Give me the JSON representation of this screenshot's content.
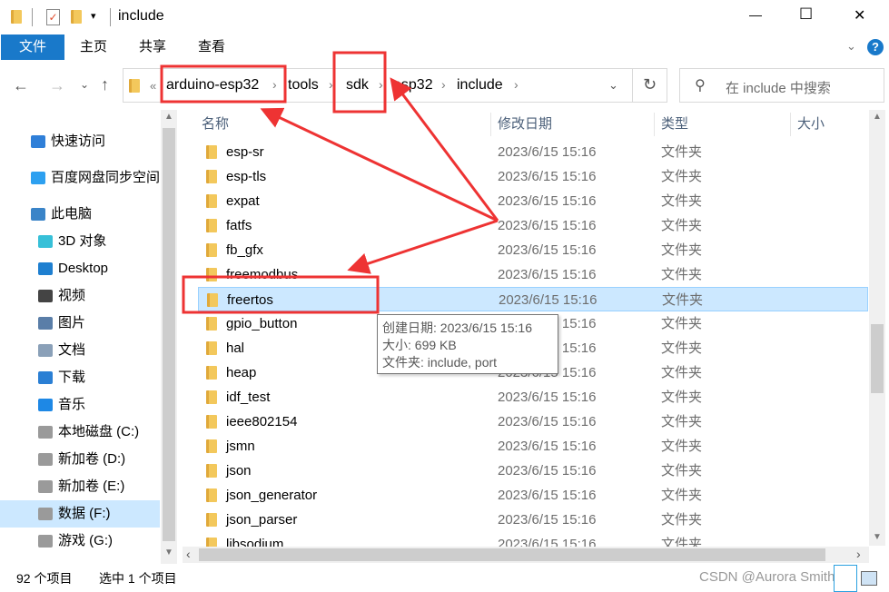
{
  "window": {
    "title": "include",
    "minimize": "—",
    "maximize": "☐",
    "close": "✕"
  },
  "ribbon": {
    "tabs": [
      "文件",
      "主页",
      "共享",
      "查看"
    ]
  },
  "address": {
    "overflow": "«",
    "crumbs": [
      "arduino-esp32",
      "tools",
      "sdk",
      "esp32",
      "include"
    ]
  },
  "search": {
    "placeholder": "在 include 中搜索"
  },
  "sidebar": {
    "items": [
      {
        "label": "快速访问",
        "icon": "star-icon"
      },
      {
        "label": "百度网盘同步空间",
        "icon": "baidu-netdisk-icon"
      },
      {
        "label": "此电脑",
        "icon": "computer-icon"
      },
      {
        "label": "3D 对象",
        "icon": "cube-icon"
      },
      {
        "label": "Desktop",
        "icon": "desktop-icon"
      },
      {
        "label": "视频",
        "icon": "video-icon"
      },
      {
        "label": "图片",
        "icon": "picture-icon"
      },
      {
        "label": "文档",
        "icon": "document-icon"
      },
      {
        "label": "下载",
        "icon": "download-icon"
      },
      {
        "label": "音乐",
        "icon": "music-icon"
      },
      {
        "label": "本地磁盘 (C:)",
        "icon": "drive-icon"
      },
      {
        "label": "新加卷 (D:)",
        "icon": "drive-icon"
      },
      {
        "label": "新加卷 (E:)",
        "icon": "drive-icon"
      },
      {
        "label": "数据 (F:)",
        "icon": "drive-icon",
        "selected": true
      },
      {
        "label": "游戏 (G:)",
        "icon": "drive-icon"
      }
    ]
  },
  "columns": [
    "名称",
    "修改日期",
    "类型",
    "大小"
  ],
  "files": [
    {
      "name": "esp-sr",
      "date": "2023/6/15 15:16",
      "type": "文件夹"
    },
    {
      "name": "esp-tls",
      "date": "2023/6/15 15:16",
      "type": "文件夹"
    },
    {
      "name": "expat",
      "date": "2023/6/15 15:16",
      "type": "文件夹"
    },
    {
      "name": "fatfs",
      "date": "2023/6/15 15:16",
      "type": "文件夹"
    },
    {
      "name": "fb_gfx",
      "date": "2023/6/15 15:16",
      "type": "文件夹"
    },
    {
      "name": "freemodbus",
      "date": "2023/6/15 15:16",
      "type": "文件夹"
    },
    {
      "name": "freertos",
      "date": "2023/6/15 15:16",
      "type": "文件夹",
      "selected": true
    },
    {
      "name": "gpio_button",
      "date": "2023/6/15 15:16",
      "type": "文件夹"
    },
    {
      "name": "hal",
      "date": "2023/6/15 15:16",
      "type": "文件夹"
    },
    {
      "name": "heap",
      "date": "2023/6/15 15:16",
      "type": "文件夹"
    },
    {
      "name": "idf_test",
      "date": "2023/6/15 15:16",
      "type": "文件夹"
    },
    {
      "name": "ieee802154",
      "date": "2023/6/15 15:16",
      "type": "文件夹"
    },
    {
      "name": "jsmn",
      "date": "2023/6/15 15:16",
      "type": "文件夹"
    },
    {
      "name": "json",
      "date": "2023/6/15 15:16",
      "type": "文件夹"
    },
    {
      "name": "json_generator",
      "date": "2023/6/15 15:16",
      "type": "文件夹"
    },
    {
      "name": "json_parser",
      "date": "2023/6/15 15:16",
      "type": "文件夹"
    },
    {
      "name": "libsodium",
      "date": "2023/6/15 15:16",
      "type": "文件夹"
    }
  ],
  "tooltip": [
    "创建日期: 2023/6/15 15:16",
    "大小: 699 KB",
    "文件夹: include, port"
  ],
  "status": {
    "count": "92 个项目",
    "selected": "选中 1 个项目"
  },
  "watermark": "CSDN @Aurora Smith",
  "colors": {
    "accent": "#1979ca",
    "selection": "#cce8ff",
    "annotation": "#ee3333"
  }
}
